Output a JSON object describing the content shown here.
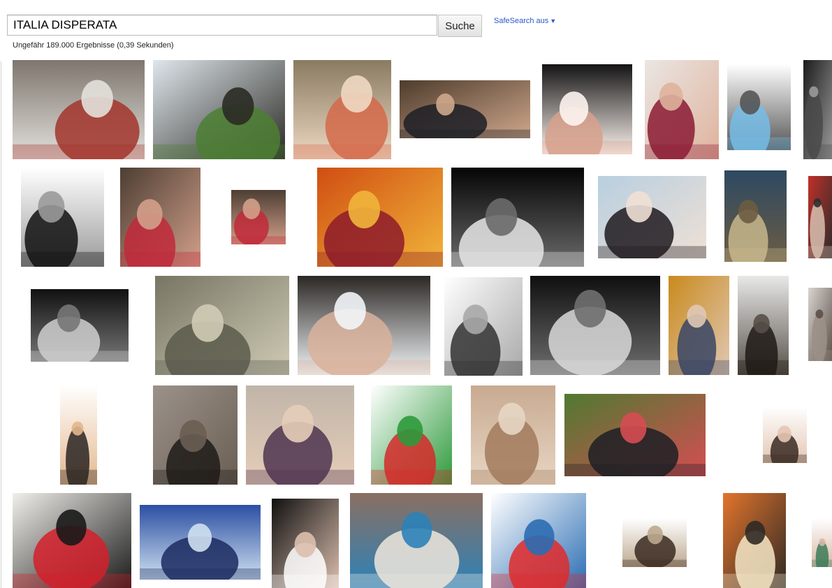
{
  "search": {
    "query": "ITALIA DISPERATA",
    "button_label": "Suche"
  },
  "safesearch": {
    "label": "SafeSearch aus",
    "arrow": "▼"
  },
  "stats": "Ungefähr 189.000 Ergebnisse (0,39 Sekunden)",
  "thumbnails": [
    {
      "name": "thumb-street-garbage",
      "icon": "street-garbage-image",
      "colors": [
        "#7e766e",
        "#a2352c",
        "#e3e0dc"
      ]
    },
    {
      "name": "thumb-cross-hill",
      "icon": "cross-hill-image",
      "colors": [
        "#dfe6ec",
        "#4c7f33",
        "#2b2b25"
      ]
    },
    {
      "name": "thumb-bald-man-costume",
      "icon": "bald-man-costume-image",
      "colors": [
        "#897b61",
        "#d36a4a",
        "#efd8c3"
      ]
    },
    {
      "name": "thumb-man-hand-face",
      "icon": "man-hand-face-image",
      "colors": [
        "#4e3c2c",
        "#1d1f26",
        "#cfa78c"
      ]
    },
    {
      "name": "thumb-girl-scream",
      "icon": "girl-scream-image",
      "colors": [
        "#141414",
        "#d7a18c",
        "#fdf4ef"
      ]
    },
    {
      "name": "thumb-woman-red-dress",
      "icon": "woman-red-dress-image",
      "colors": [
        "#eae6e3",
        "#8b1a33",
        "#dfb29c"
      ]
    },
    {
      "name": "thumb-comic-strip",
      "icon": "comic-strip-image",
      "colors": [
        "#ffffff",
        "#75bde8",
        "#555555"
      ]
    },
    {
      "name": "thumb-dark-partial",
      "icon": "dark-partial-image",
      "colors": [
        "#1b1b1b",
        "#4a4a4a",
        "#9a9a9a"
      ]
    },
    {
      "name": "thumb-fashion-collage",
      "icon": "fashion-collage-image",
      "colors": [
        "#ffffff",
        "#111111",
        "#9a9a9a"
      ]
    },
    {
      "name": "thumb-woman-crying",
      "icon": "woman-crying-image",
      "colors": [
        "#4d3e33",
        "#c1293a",
        "#d2a08a"
      ]
    },
    {
      "name": "thumb-woman-crying-small",
      "icon": "woman-crying-small-image",
      "colors": [
        "#4d3e33",
        "#c1293a",
        "#d2a08a"
      ]
    },
    {
      "name": "thumb-as-roma-crest",
      "icon": "as-roma-crest-image",
      "colors": [
        "#d04e12",
        "#8d1b2a",
        "#f1b53a"
      ]
    },
    {
      "name": "thumb-white-ponytail",
      "icon": "white-ponytail-image",
      "colors": [
        "#050505",
        "#e6e6e6",
        "#6a6a6a"
      ]
    },
    {
      "name": "thumb-woman-blonde-bob",
      "icon": "woman-blonde-bob-image",
      "colors": [
        "#b8cfe0",
        "#1f1a1e",
        "#efe0d5"
      ]
    },
    {
      "name": "thumb-dvd-cover",
      "icon": "dvd-cover-image",
      "colors": [
        "#2d4962",
        "#c7b78c",
        "#6b5c43"
      ]
    },
    {
      "name": "thumb-edge-partial",
      "icon": "edge-partial-image",
      "colors": [
        "#c13028",
        "#d8c0b0",
        "#2c2c2c"
      ]
    },
    {
      "name": "thumb-bw-body",
      "icon": "bw-body-image",
      "colors": [
        "#111111",
        "#cfcfcf",
        "#777777"
      ]
    },
    {
      "name": "thumb-soldiers-gas-masks",
      "icon": "soldiers-gas-masks-image",
      "colors": [
        "#777563",
        "#5a5a4c",
        "#cfcbb5"
      ]
    },
    {
      "name": "thumb-girl-selfie",
      "icon": "girl-selfie-image",
      "colors": [
        "#2b2724",
        "#d9b29c",
        "#f2f5f8"
      ]
    },
    {
      "name": "thumb-macelleria-sociale",
      "icon": "macelleria-sociale-cartoon-image",
      "colors": [
        "#ffffff",
        "#333333",
        "#a8a8a8"
      ]
    },
    {
      "name": "thumb-curly-hair-bw",
      "icon": "curly-hair-bw-image",
      "colors": [
        "#0f0f0f",
        "#d9d9d9",
        "#6f6f6f"
      ]
    },
    {
      "name": "thumb-man-yellow-shirt",
      "icon": "man-yellow-shirt-image",
      "colors": [
        "#c98a1c",
        "#384565",
        "#e0c8b4"
      ]
    },
    {
      "name": "thumb-bronze-statue",
      "icon": "bronze-statue-image",
      "colors": [
        "#e8e8e8",
        "#1f1a16",
        "#575048"
      ]
    },
    {
      "name": "thumb-edge-partial-2",
      "icon": "edge-partial-image",
      "colors": [
        "#d8d4d0",
        "#9c9087",
        "#5c5049"
      ]
    },
    {
      "name": "thumb-blonde-woman",
      "icon": "blonde-woman-image",
      "colors": [
        "#ffffff",
        "#2a2422",
        "#e3b78d"
      ]
    },
    {
      "name": "thumb-dog",
      "icon": "dog-image",
      "colors": [
        "#9b928a",
        "#1e1b18",
        "#6a5e53"
      ]
    },
    {
      "name": "thumb-woman-lounging",
      "icon": "woman-lounging-image",
      "colors": [
        "#c0b5a9",
        "#4f344f",
        "#e6cdb8"
      ]
    },
    {
      "name": "thumb-italy-map-flag",
      "icon": "italy-map-flag-image",
      "colors": [
        "#ffffff",
        "#d52a2a",
        "#2e9a3c"
      ]
    },
    {
      "name": "thumb-fresco-wall",
      "icon": "fresco-wall-image",
      "colors": [
        "#c8aa90",
        "#a27a5c",
        "#e7d6c4"
      ]
    },
    {
      "name": "thumb-group-outdoor",
      "icon": "group-outdoor-image",
      "colors": [
        "#4f7a31",
        "#1d1f24",
        "#d64d52"
      ]
    },
    {
      "name": "thumb-woman-smiling",
      "icon": "woman-smiling-image",
      "colors": [
        "#ffffff",
        "#3a2a22",
        "#e4c6b3"
      ]
    },
    {
      "name": "thumb-crystals-event",
      "icon": "crystals-event-image",
      "colors": [
        "#f0efea",
        "#d3202a",
        "#1a1a1a"
      ]
    },
    {
      "name": "thumb-football-players",
      "icon": "football-players-image",
      "colors": [
        "#2b4fa3",
        "#1b2a60",
        "#cfe0ef"
      ]
    },
    {
      "name": "thumb-emo-girl",
      "icon": "emo-girl-image",
      "colors": [
        "#101010",
        "#ffffff",
        "#dcbfae"
      ]
    },
    {
      "name": "thumb-celeste-cats",
      "icon": "celeste-cats-image",
      "colors": [
        "#8a6f62",
        "#efe6dc",
        "#2c82b8"
      ]
    },
    {
      "name": "thumb-veiligheid-poster",
      "icon": "veiligheid-poster-image",
      "colors": [
        "#ffffff",
        "#e02a2a",
        "#2b6db3"
      ]
    },
    {
      "name": "thumb-woman-scarf",
      "icon": "woman-scarf-image",
      "colors": [
        "#ffffff",
        "#3b2a20",
        "#bca88f"
      ]
    },
    {
      "name": "thumb-pasolini-book",
      "icon": "pasolini-book-image",
      "colors": [
        "#e3742c",
        "#f4e6c5",
        "#2f2a25"
      ]
    },
    {
      "name": "thumb-edge-partial-3",
      "icon": "edge-partial-image",
      "colors": [
        "#ffffff",
        "#3c7b58",
        "#d8b7a5"
      ]
    }
  ]
}
